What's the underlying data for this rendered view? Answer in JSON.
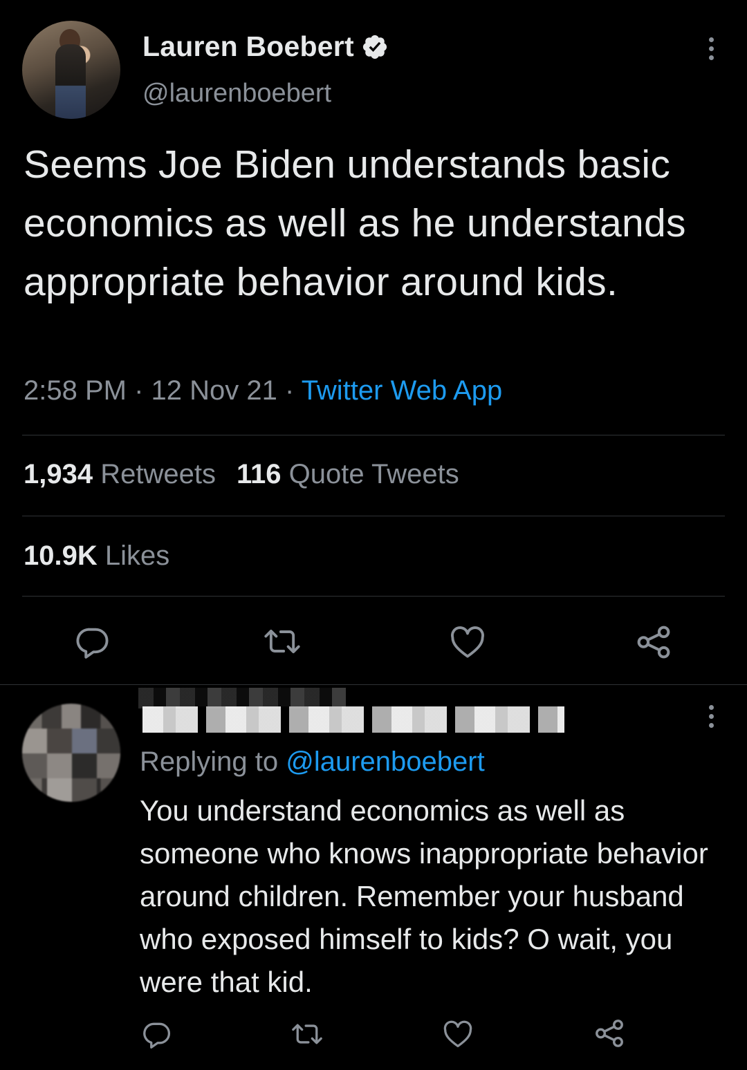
{
  "tweet": {
    "author_name": "Lauren Boebert",
    "handle": "@laurenboebert",
    "text": "Seems Joe Biden understands basic economics as well as he understands appropriate behavior around kids.",
    "time": "2:58 PM",
    "sep1": " · ",
    "date": "12 Nov 21",
    "sep2": " · ",
    "source": "Twitter Web App",
    "retweets_count": "1,934",
    "retweets_label": " Retweets",
    "quotes_count": "116",
    "quotes_label": " Quote Tweets",
    "likes_count": "10.9K",
    "likes_label": " Likes"
  },
  "reply": {
    "replying_prefix": "Replying to ",
    "replying_handle": "@laurenboebert",
    "text": "You understand economics as well as someone who knows inappropriate behavior around children.  Remember your husband who exposed himself to kids? O wait,  you were that kid."
  },
  "icons": {
    "reply": "reply-icon",
    "retweet": "retweet-icon",
    "like": "heart-icon",
    "share": "share-icon",
    "more": "more-icon",
    "verified": "verified-badge-icon"
  },
  "colors": {
    "background": "#000000",
    "text": "#e7e9ea",
    "muted": "#8b9199",
    "link": "#1d9bf0",
    "divider": "#2f3336"
  }
}
